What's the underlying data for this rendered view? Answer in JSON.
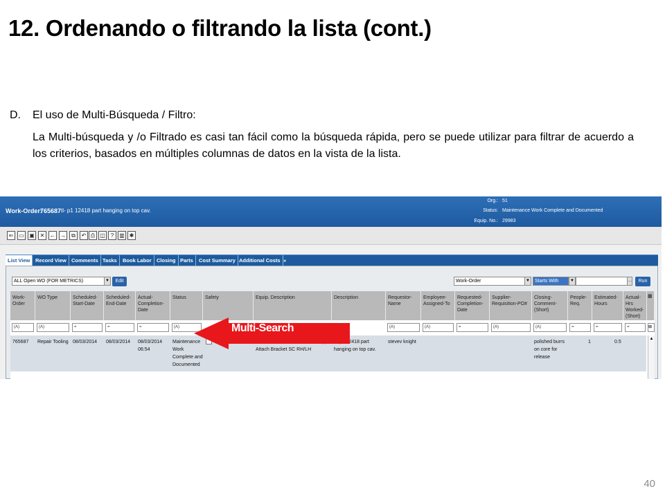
{
  "slide": {
    "title": "12. Ordenando o filtrando la lista (cont.)",
    "bullet_marker": "D.",
    "bullet_text": "El uso de Multi-Búsqueda  / Filtro:",
    "paragraph": "La Multi-búsqueda y /o Filtrado es casi tan fácil como la búsqueda rápida, pero se puede utilizar para filtrar de acuerdo a los criterios,  basados en múltiples columnas de datos en la vista de la lista.",
    "page_number": "40"
  },
  "screenshot": {
    "wo_label": "Work-Order:",
    "wo_number": "765687",
    "wo_desc": "tl- p1 12418 part hanging on top cav.",
    "org_label": "Org.:",
    "org_value": "51",
    "status_label": "Status:",
    "status_value": "Maintenance Work Complete and Documented",
    "equip_label": "Equip. No.:",
    "equip_value": "29983",
    "tabs": [
      "List View",
      "Record View",
      "Comments",
      "Tasks",
      "Book Labor",
      "Closing",
      "Parts",
      "Cost Summary",
      "Additional Costs",
      "»"
    ],
    "dataspy_value": "ALL Open WO (FOR METRICS)",
    "edit_label": "Edit",
    "filter_field": "Work-Order",
    "filter_op": "Starts With",
    "run_label": "Run",
    "columns": [
      "Work-Order",
      "WO Type",
      "Scheduled-Start-Date",
      "Scheduled-End-Date",
      "Actual-Completion-Date",
      "Status",
      "Safety",
      "Equip. Description",
      "Description",
      "Requestor-Name",
      "Employee-Assigned-To",
      "Requested-Completion-Date",
      "Supplier-Requisition-PO#",
      "Closing-Comment-(Short)",
      "People-Req.",
      "Estimated-Hours",
      "Actual-Hrs Worked-(Short)"
    ],
    "filter_markers": [
      "(A)",
      "(A)",
      "=",
      "=",
      "=",
      "(A)",
      "",
      "(A)",
      "(A)",
      "(A)",
      "(A)",
      "=",
      "(A)",
      "(A)",
      "=",
      "=",
      "="
    ],
    "row": {
      "work_order": "765687",
      "wo_type": "Repair Tooling",
      "start": "08/03/2014",
      "end": "08/03/2014",
      "completed": "08/03/2014 06:54",
      "status": "Maintenance Work Complete and Documented",
      "equip": "1-  2418 FORD P473 C-Pillar Upper Attach Bracket SC RH/LH",
      "description": "tl- p1 12418 part hanging on top cav.",
      "requestor": "stevev knight",
      "closing": "polished burrs on core for release",
      "people": "1",
      "est_hours": "0.5"
    }
  },
  "annotation": {
    "label": "Multi-Search",
    "color": "#e8171c"
  }
}
